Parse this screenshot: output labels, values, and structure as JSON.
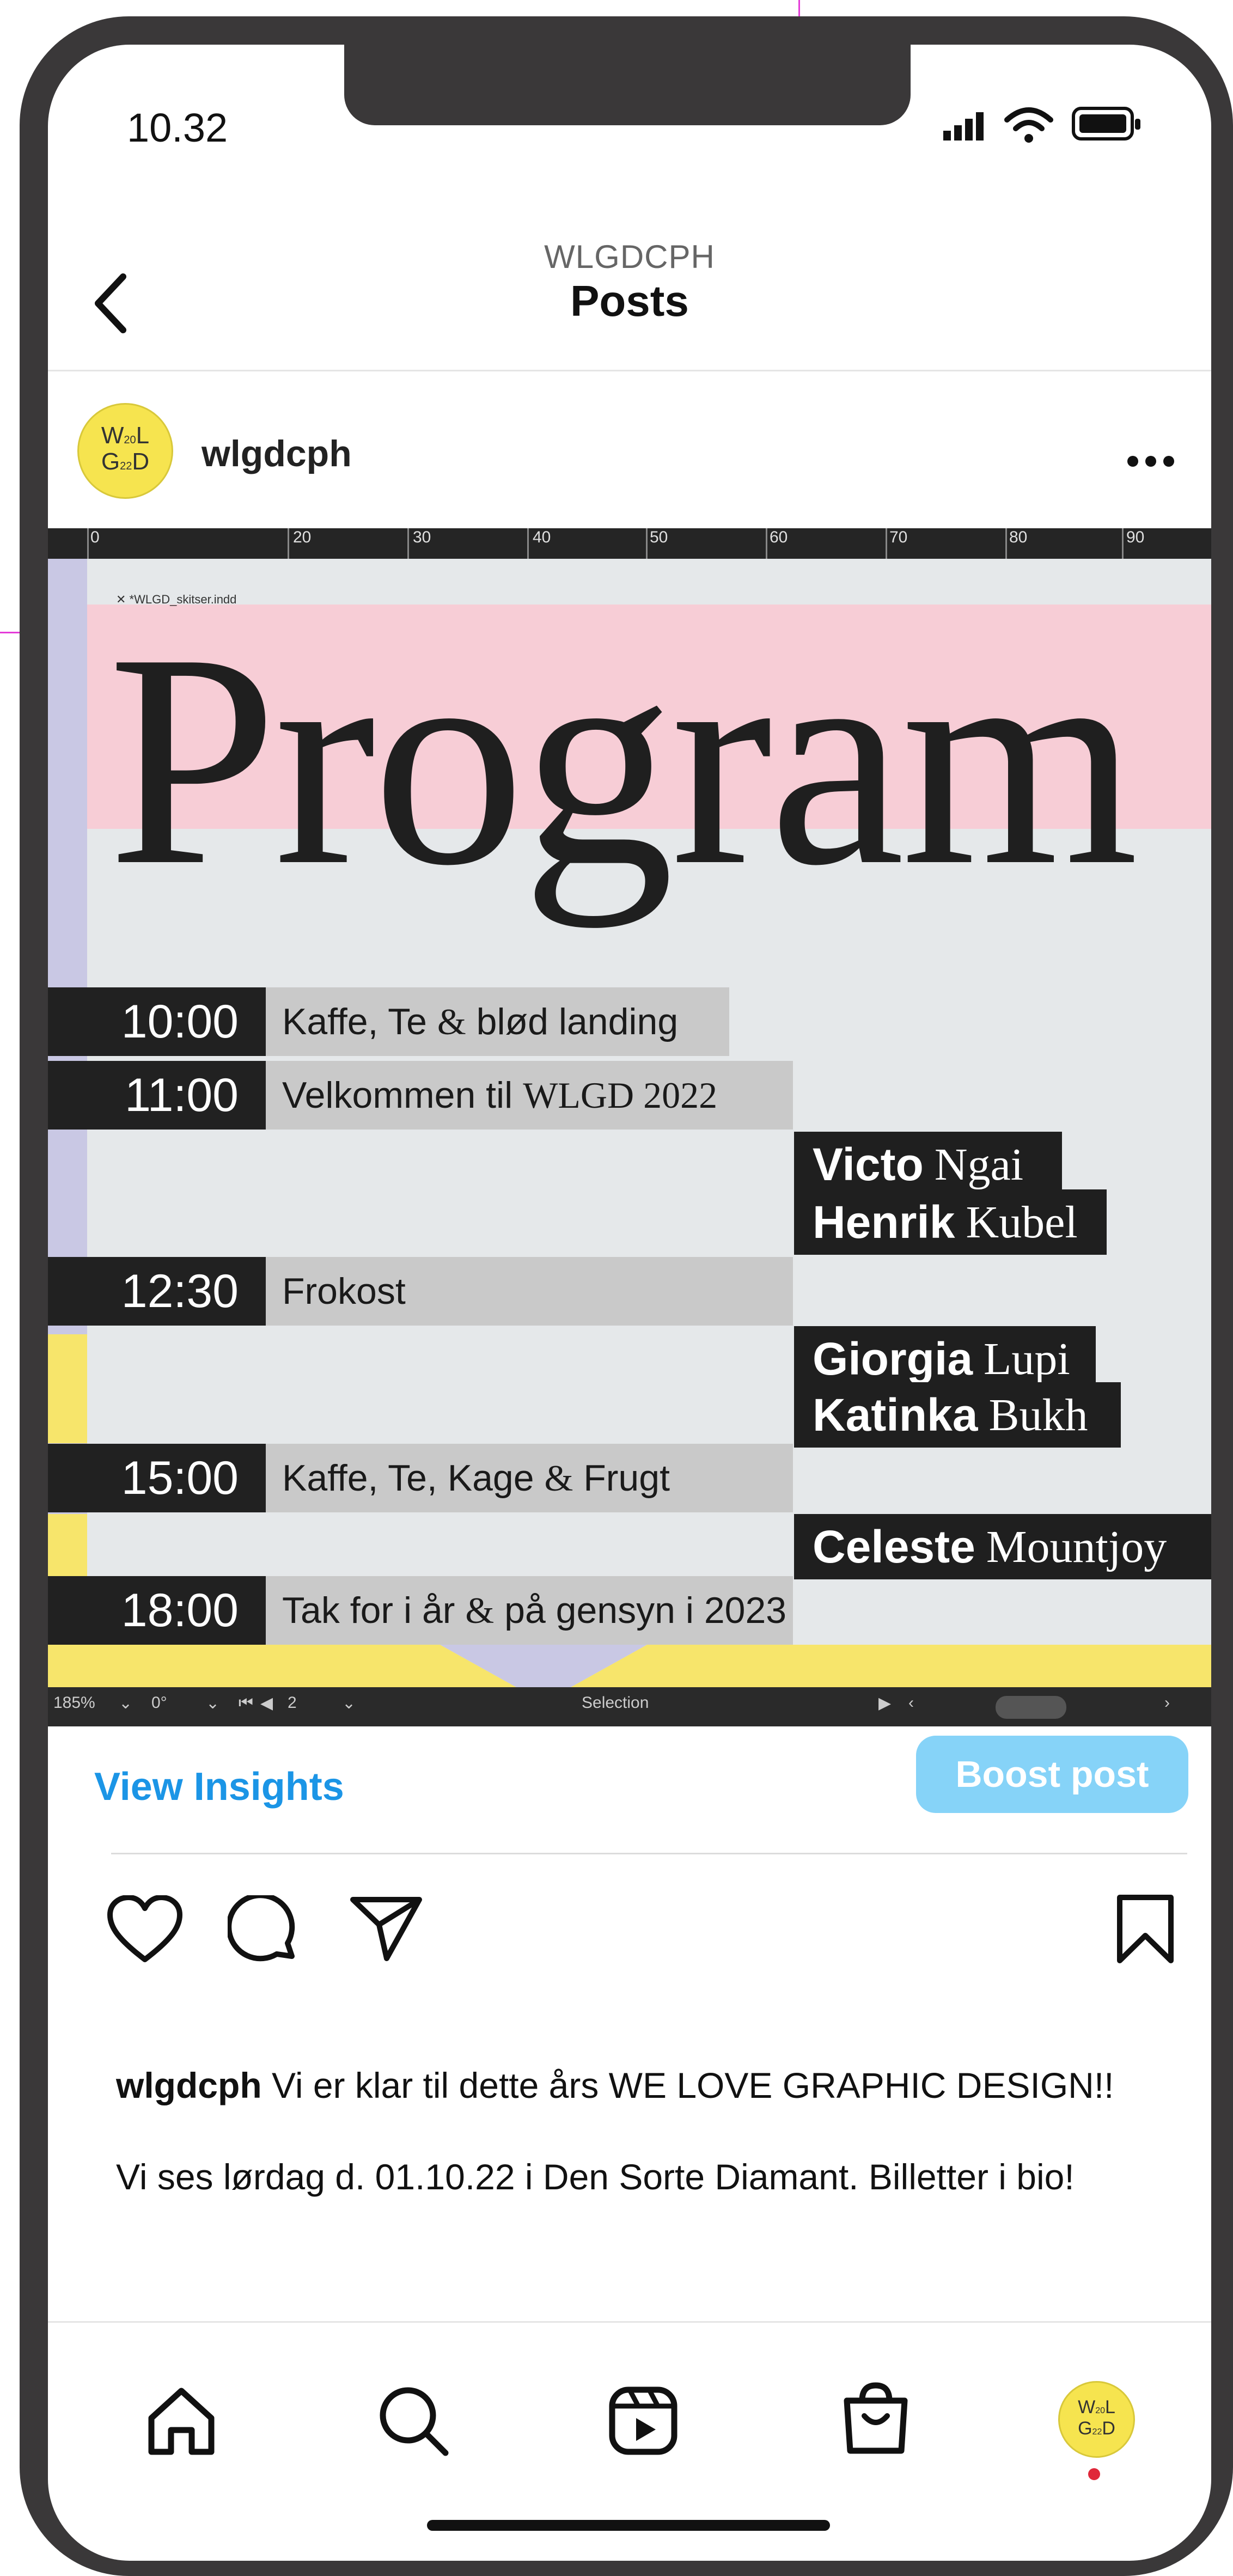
{
  "status_bar": {
    "time": "10.32",
    "icons": [
      "signal-icon",
      "wifi-icon",
      "battery-icon"
    ]
  },
  "header": {
    "account": "WLGDCPH",
    "title": "Posts",
    "back_icon": "chevron-left-icon"
  },
  "post_header": {
    "username": "wlgdcph",
    "avatar_text": "W20GLD22D",
    "more_icon": "more-horizontal-icon"
  },
  "post_image": {
    "ruler_numbers": [
      "0",
      "20",
      "30",
      "40",
      "50",
      "60",
      "70",
      "80",
      "90"
    ],
    "document_tab": "*WLGD_skitser.indd",
    "heading": "Program",
    "schedule": [
      {
        "time": "10:00",
        "event_sans": "Kaffe, Te ",
        "event_amp": "&",
        "event_rest": " blød landing"
      },
      {
        "time": "11:00",
        "event_sans": "Velkommen til ",
        "event_amp": "WLGD 2022",
        "event_rest": ""
      },
      {
        "time": "12:30",
        "event_sans": "Frokost",
        "event_amp": "",
        "event_rest": ""
      },
      {
        "time": "15:00",
        "event_sans": "Kaffe, Te, Kage ",
        "event_amp": "&",
        "event_rest": " Frugt"
      },
      {
        "time": "18:00",
        "event_sans": "Tak for i år ",
        "event_amp": "&",
        "event_rest": " på gensyn i 2023"
      }
    ],
    "speakers": [
      {
        "first": "Victo",
        "last": "Ngai"
      },
      {
        "first": "Henrik",
        "last": "Kubel"
      },
      {
        "first": "Giorgia",
        "last": "Lupi"
      },
      {
        "first": "Katinka",
        "last": "Bukh"
      },
      {
        "first": "Celeste",
        "last": "Mountjoy"
      }
    ],
    "status_bar": {
      "zoom": "185%",
      "angle": "0°",
      "page": "2",
      "mode": "Selection"
    },
    "colors": {
      "pink": "#f7cdd6",
      "lavender": "#c9c8e4",
      "yellow": "#f7e56b",
      "dark": "#212121",
      "grey_box": "#c9c9c9"
    }
  },
  "actions": {
    "view_insights": "View Insights",
    "boost_post": "Boost post",
    "icons": [
      "heart-icon",
      "comment-icon",
      "share-icon",
      "bookmark-icon"
    ]
  },
  "caption": {
    "username": "wlgdcph",
    "line1": " Vi er klar til dette års WE LOVE GRAPHIC DESIGN!!",
    "line2": "Vi ses lørdag d. 01.10.22 i Den Sorte Diamant. Billetter i bio!"
  },
  "bottom_nav": {
    "items": [
      "home-icon",
      "search-icon",
      "reels-icon",
      "shop-icon",
      "profile-avatar"
    ]
  },
  "accent_colors": {
    "link_blue": "#1b95e6",
    "boost_blue": "#86d3f8",
    "notification_red": "#e0283a"
  }
}
